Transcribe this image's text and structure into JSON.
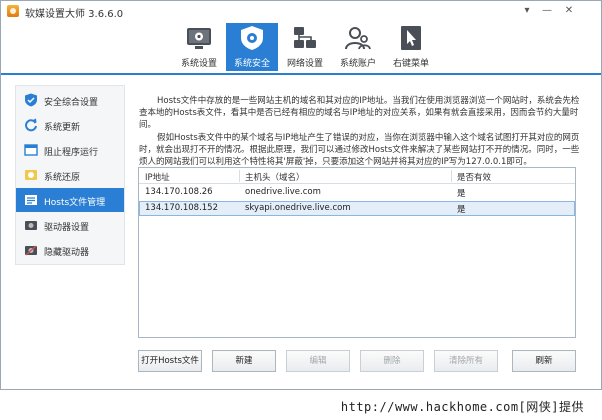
{
  "window": {
    "title": "软媒设置大师 3.6.6.0",
    "controls": {
      "min": "▾",
      "max": "—",
      "close": "✕"
    }
  },
  "toolbar": {
    "tabs": [
      {
        "label": "系统设置",
        "icon": "system-settings-icon"
      },
      {
        "label": "系统安全",
        "icon": "shield-gear-icon",
        "active": true
      },
      {
        "label": "网络设置",
        "icon": "network-icon"
      },
      {
        "label": "系统账户",
        "icon": "users-icon"
      },
      {
        "label": "右键菜单",
        "icon": "cursor-icon"
      }
    ]
  },
  "sidebar": {
    "items": [
      {
        "label": "安全综合设置",
        "icon": "shield-check-icon"
      },
      {
        "label": "系统更新",
        "icon": "refresh-icon"
      },
      {
        "label": "阻止程序运行",
        "icon": "window-block-icon"
      },
      {
        "label": "系统还原",
        "icon": "restore-icon"
      },
      {
        "label": "Hosts文件管理",
        "icon": "hosts-file-icon",
        "active": true
      },
      {
        "label": "驱动器设置",
        "icon": "drive-icon"
      },
      {
        "label": "隐藏驱动器",
        "icon": "hidden-drive-icon"
      }
    ]
  },
  "description": {
    "para1": [
      "Hosts文件中存放的是一些网站主机的域名和其对应的IP地址。当我们在使用浏览器浏览一个网站时，系统会先检",
      "查本地的Hosts表文件，看其中是否已经有相应的域名与IP地址的对应关系，如果有就会直接采用，因而会节约大量时",
      "间。"
    ],
    "para2": [
      "假如Hosts表文件中的某个域名与IP地址产生了错误的对应，当你在浏览器中输入这个域名试图打开其对应的网页",
      "时，就会出现打不开的情况。根据此原理，我们可以通过修改Hosts文件来解决了某些网站打不开的情况。同时，一些",
      "烦人的网站我们可以利用这个特性将其'屏蔽'掉，只要添加这个网站并将其对应的IP写为127.0.0.1即可。"
    ]
  },
  "hosts_table": {
    "columns": [
      "IP地址",
      "主机头（域名）",
      "是否有效"
    ],
    "rows": [
      {
        "ip": "134.170.108.26",
        "host": "onedrive.live.com",
        "valid": "是"
      },
      {
        "ip": "134.170.108.152",
        "host": "skyapi.onedrive.live.com",
        "valid": "是",
        "selected": true
      }
    ]
  },
  "buttons": {
    "open_hosts": "打开Hosts文件",
    "new": "新建",
    "edit": "编辑",
    "delete": "删除",
    "clear_all": "清除所有",
    "refresh": "刷新"
  },
  "watermark": "http://www.hackhome.com[网侠]提供",
  "colors": {
    "accent": "#2a7fd4",
    "selected_row": "#e3eef9"
  }
}
